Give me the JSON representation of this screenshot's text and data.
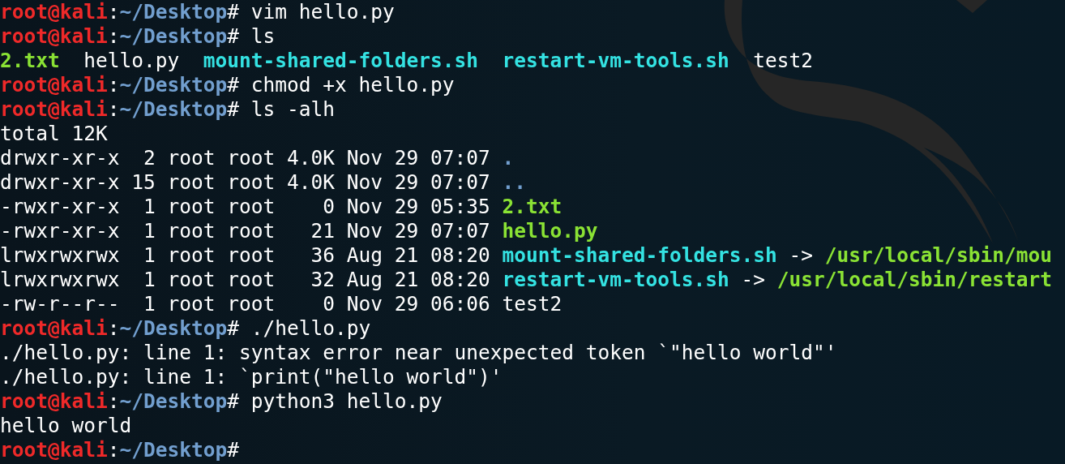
{
  "terminal": {
    "lines": [
      {
        "segments": [
          {
            "kind": "user",
            "text": "root@kali"
          },
          {
            "kind": "plain",
            "text": ":"
          },
          {
            "kind": "path",
            "text": "~/Desktop"
          },
          {
            "kind": "plain",
            "text": "# vim hello.py"
          }
        ]
      },
      {
        "segments": [
          {
            "kind": "user",
            "text": "root@kali"
          },
          {
            "kind": "plain",
            "text": ":"
          },
          {
            "kind": "path",
            "text": "~/Desktop"
          },
          {
            "kind": "plain",
            "text": "# ls"
          }
        ]
      },
      {
        "segments": [
          {
            "kind": "exec",
            "text": "2.txt  "
          },
          {
            "kind": "plain",
            "text": "hello.py  "
          },
          {
            "kind": "link",
            "text": "mount-shared-folders.sh  "
          },
          {
            "kind": "link",
            "text": "restart-vm-tools.sh  "
          },
          {
            "kind": "plain",
            "text": "test2"
          }
        ]
      },
      {
        "segments": [
          {
            "kind": "user",
            "text": "root@kali"
          },
          {
            "kind": "plain",
            "text": ":"
          },
          {
            "kind": "path",
            "text": "~/Desktop"
          },
          {
            "kind": "plain",
            "text": "# chmod +x hello.py"
          }
        ]
      },
      {
        "segments": [
          {
            "kind": "user",
            "text": "root@kali"
          },
          {
            "kind": "plain",
            "text": ":"
          },
          {
            "kind": "path",
            "text": "~/Desktop"
          },
          {
            "kind": "plain",
            "text": "# ls -alh"
          }
        ]
      },
      {
        "segments": [
          {
            "kind": "plain",
            "text": "total 12K"
          }
        ]
      },
      {
        "segments": [
          {
            "kind": "plain",
            "text": "drwxr-xr-x  2 root root 4.0K Nov 29 07:07 "
          },
          {
            "kind": "dir",
            "text": "."
          }
        ]
      },
      {
        "segments": [
          {
            "kind": "plain",
            "text": "drwxr-xr-x 15 root root 4.0K Nov 29 07:07 "
          },
          {
            "kind": "dir",
            "text": ".."
          }
        ]
      },
      {
        "segments": [
          {
            "kind": "plain",
            "text": "-rwxr-xr-x  1 root root    0 Nov 29 05:35 "
          },
          {
            "kind": "exec",
            "text": "2.txt"
          }
        ]
      },
      {
        "segments": [
          {
            "kind": "plain",
            "text": "-rwxr-xr-x  1 root root   21 Nov 29 07:07 "
          },
          {
            "kind": "exec",
            "text": "hello.py"
          }
        ]
      },
      {
        "segments": [
          {
            "kind": "plain",
            "text": "lrwxrwxrwx  1 root root   36 Aug 21 08:20 "
          },
          {
            "kind": "link",
            "text": "mount-shared-folders.sh "
          },
          {
            "kind": "plain",
            "text": "-> "
          },
          {
            "kind": "exec",
            "text": "/usr/local/sbin/mou"
          }
        ]
      },
      {
        "segments": [
          {
            "kind": "plain",
            "text": "lrwxrwxrwx  1 root root   32 Aug 21 08:20 "
          },
          {
            "kind": "link",
            "text": "restart-vm-tools.sh "
          },
          {
            "kind": "plain",
            "text": "-> "
          },
          {
            "kind": "exec",
            "text": "/usr/local/sbin/restart"
          }
        ]
      },
      {
        "segments": [
          {
            "kind": "plain",
            "text": "-rw-r--r--  1 root root    0 Nov 29 06:06 test2"
          }
        ]
      },
      {
        "segments": [
          {
            "kind": "user",
            "text": "root@kali"
          },
          {
            "kind": "plain",
            "text": ":"
          },
          {
            "kind": "path",
            "text": "~/Desktop"
          },
          {
            "kind": "plain",
            "text": "# ./hello.py"
          }
        ]
      },
      {
        "segments": [
          {
            "kind": "plain",
            "text": "./hello.py: line 1: syntax error near unexpected token `\"hello world\"'"
          }
        ]
      },
      {
        "segments": [
          {
            "kind": "plain",
            "text": "./hello.py: line 1: `print(\"hello world\")'"
          }
        ]
      },
      {
        "segments": [
          {
            "kind": "user",
            "text": "root@kali"
          },
          {
            "kind": "plain",
            "text": ":"
          },
          {
            "kind": "path",
            "text": "~/Desktop"
          },
          {
            "kind": "plain",
            "text": "# python3 hello.py"
          }
        ]
      },
      {
        "segments": [
          {
            "kind": "plain",
            "text": "hello world"
          }
        ]
      },
      {
        "segments": [
          {
            "kind": "user",
            "text": "root@kali"
          },
          {
            "kind": "plain",
            "text": ":"
          },
          {
            "kind": "path",
            "text": "~/Desktop"
          },
          {
            "kind": "plain",
            "text": "#"
          }
        ]
      }
    ]
  }
}
